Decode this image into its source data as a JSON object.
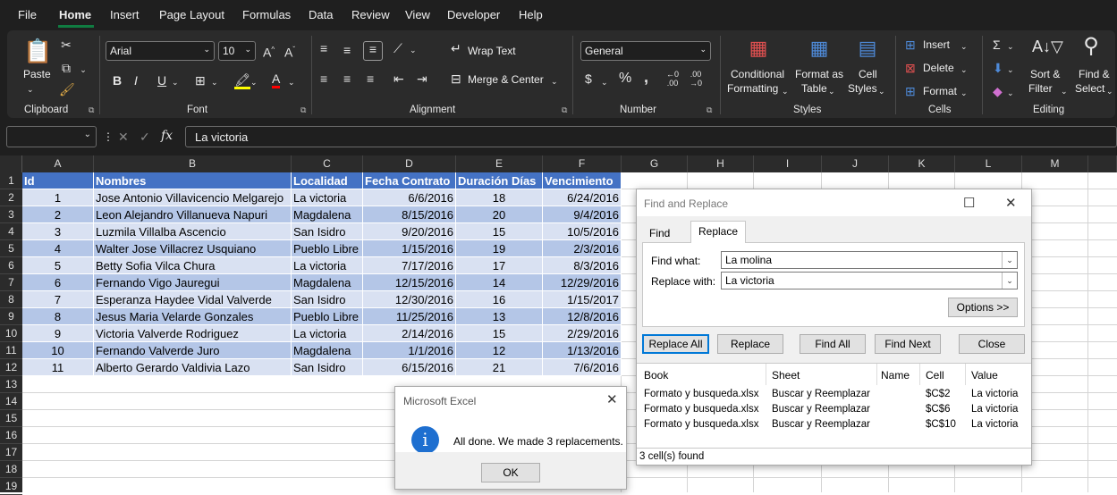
{
  "menu": {
    "items": [
      "File",
      "Home",
      "Insert",
      "Page Layout",
      "Formulas",
      "Data",
      "Review",
      "View",
      "Developer",
      "Help"
    ]
  },
  "ribbon": {
    "clipboard": {
      "label": "Clipboard",
      "paste": "Paste"
    },
    "font": {
      "label": "Font",
      "font_name": "Arial",
      "font_size": "10"
    },
    "alignment": {
      "label": "Alignment",
      "wrap_text": "Wrap Text",
      "merge_center": "Merge & Center"
    },
    "number": {
      "label": "Number",
      "format": "General"
    },
    "styles": {
      "label": "Styles",
      "conditional_1": "Conditional",
      "conditional_2": "Formatting",
      "format_table_1": "Format as",
      "format_table_2": "Table",
      "cell_styles_1": "Cell",
      "cell_styles_2": "Styles"
    },
    "cells": {
      "label": "Cells",
      "insert": "Insert",
      "delete": "Delete",
      "format": "Format"
    },
    "editing": {
      "label": "Editing",
      "sort_1": "Sort &",
      "sort_2": "Filter",
      "find_1": "Find &",
      "find_2": "Select"
    }
  },
  "formula_bar": {
    "value": "La victoria"
  },
  "columns": [
    "A",
    "B",
    "C",
    "D",
    "E",
    "F",
    "G",
    "H",
    "I",
    "J",
    "K",
    "L",
    "M"
  ],
  "rows": [
    "1",
    "2",
    "3",
    "4",
    "5",
    "6",
    "7",
    "8",
    "9",
    "10",
    "11",
    "12",
    "13",
    "14",
    "15",
    "16",
    "17",
    "18",
    "19"
  ],
  "table": {
    "headers": [
      "Id",
      "Nombres",
      "Localidad",
      "Fecha Contrato",
      "Duración Días",
      "Vencimiento"
    ],
    "rows": [
      [
        "1",
        "Jose Antonio Villavicencio Melgarejo",
        "La victoria",
        "6/6/2016",
        "18",
        "6/24/2016"
      ],
      [
        "2",
        "Leon Alejandro  Villanueva  Napuri",
        "Magdalena",
        "8/15/2016",
        "20",
        "9/4/2016"
      ],
      [
        "3",
        "Luzmila  Villalba Ascencio",
        "San Isidro",
        "9/20/2016",
        "15",
        "10/5/2016"
      ],
      [
        "4",
        "Walter Jose Villacrez  Usquiano",
        "Pueblo Libre",
        "1/15/2016",
        "19",
        "2/3/2016"
      ],
      [
        "5",
        "Betty Sofia  Vilca   Chura",
        "La victoria",
        "7/17/2016",
        "17",
        "8/3/2016"
      ],
      [
        "6",
        "Fernando Vigo Jauregui",
        "Magdalena",
        "12/15/2016",
        "14",
        "12/29/2016"
      ],
      [
        "7",
        "Esperanza Haydee Vidal Valverde",
        "San Isidro",
        "12/30/2016",
        "16",
        "1/15/2017"
      ],
      [
        "8",
        "Jesus Maria  Velarde Gonzales",
        "Pueblo Libre",
        "11/25/2016",
        "13",
        "12/8/2016"
      ],
      [
        "9",
        "Victoria Valverde  Rodriguez",
        "La victoria",
        "2/14/2016",
        "15",
        "2/29/2016"
      ],
      [
        "10",
        "Fernando  Valverde  Juro",
        "Magdalena",
        "1/1/2016",
        "12",
        "1/13/2016"
      ],
      [
        "11",
        "Alberto Gerardo  Valdivia  Lazo",
        "San Isidro",
        "6/15/2016",
        "21",
        "7/6/2016"
      ]
    ]
  },
  "find_replace": {
    "title": "Find and Replace",
    "tab_find": "Find",
    "tab_replace": "Replace",
    "find_label": "Find what:",
    "find_value": "La molina",
    "replace_label": "Replace with:",
    "replace_value": "La victoria",
    "options_button": "Options >>",
    "replace_all": "Replace All",
    "replace": "Replace",
    "find_all": "Find All",
    "find_next": "Find Next",
    "close": "Close",
    "result_headers": [
      "Book",
      "Sheet",
      "Name",
      "Cell",
      "Value"
    ],
    "results": [
      [
        "Formato y busqueda.xlsx",
        "Buscar y Reemplazar",
        "",
        "$C$2",
        "La victoria"
      ],
      [
        "Formato y busqueda.xlsx",
        "Buscar y Reemplazar",
        "",
        "$C$6",
        "La victoria"
      ],
      [
        "Formato y busqueda.xlsx",
        "Buscar y Reemplazar",
        "",
        "$C$10",
        "La victoria"
      ]
    ],
    "status": "3 cell(s) found"
  },
  "message": {
    "title": "Microsoft Excel",
    "text": "All done. We made 3 replacements.",
    "ok": "OK"
  }
}
